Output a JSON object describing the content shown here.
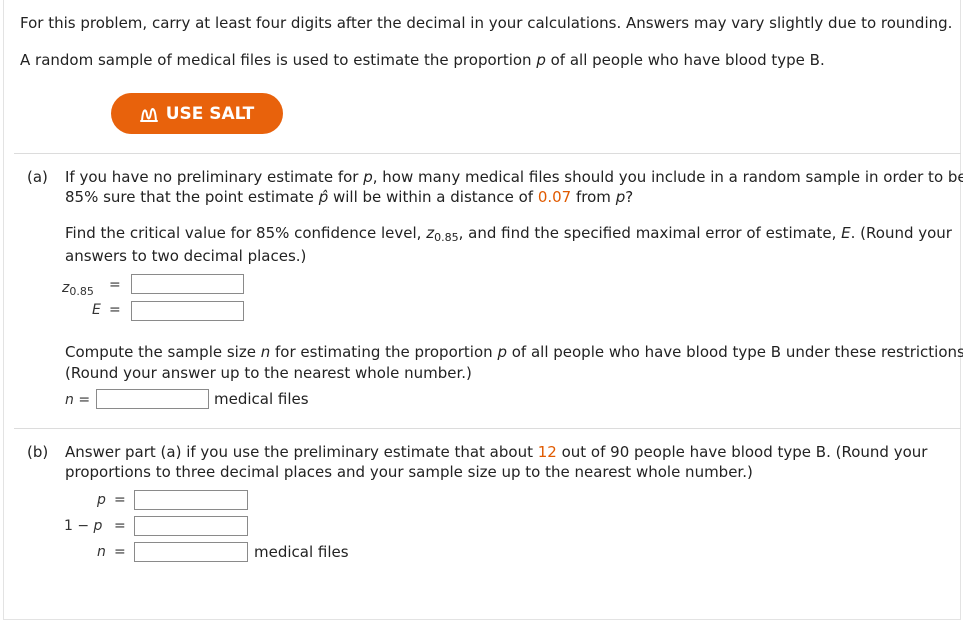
{
  "intro": {
    "line1": "For this problem, carry at least four digits after the decimal in your calculations. Answers may vary slightly due to rounding.",
    "line2_pre": "A random sample of medical files is used to estimate the proportion ",
    "line2_var": "p",
    "line2_post": " of all people who have blood type B."
  },
  "salt_button": {
    "label": "USE SALT",
    "icon": "salt-icon"
  },
  "part_a": {
    "marker": "(a)",
    "q_l1_pre": "If you have no preliminary estimate for ",
    "q_l1_var": "p",
    "q_l1_post": ", how many medical files should you include in a random sample in order to be",
    "q_l2_pre": "85% sure that the point estimate ",
    "q_l2_var": "p̂",
    "q_l2_mid": " will be within a distance of ",
    "q_l2_value": "0.07",
    "q_l2_mid2": " from ",
    "q_l2_var2": "p",
    "q_l2_post": "?",
    "find_l1_pre": "Find the critical value for 85% confidence level, ",
    "find_l1_z": "z",
    "find_l1_sub": "0.85",
    "find_l1_mid": ", and find the specified maximal error of estimate, ",
    "find_l1_var": "E",
    "find_l1_post": ". (Round your",
    "find_l2": "answers to two decimal places.)",
    "z_label": "z",
    "z_sub": "0.85",
    "eq": "=",
    "e_label": "E",
    "z_value": "",
    "e_value": "",
    "compute_l1_pre": "Compute the sample size ",
    "compute_l1_var": "n",
    "compute_l1_mid": " for estimating the proportion ",
    "compute_l1_var2": "p",
    "compute_l1_post": " of all people who have blood type B under these restrictions.",
    "compute_l2": "(Round your answer up to the nearest whole number.)",
    "n_label": "n",
    "n_value": "",
    "n_unit": "medical files"
  },
  "part_b": {
    "marker": "(b)",
    "q_l1_pre": "Answer part (a) if you use the preliminary estimate that about ",
    "q_l1_value": "12",
    "q_l1_post": " out of 90 people have blood type B. (Round your",
    "q_l2": "proportions to three decimal places and your sample size up to the nearest whole number.)",
    "p_label": "p",
    "one_minus": "1 − ",
    "eq": "=",
    "n_label": "n",
    "p_value": "",
    "one_minus_p_value": "",
    "n_value": "",
    "n_unit": "medical files"
  },
  "colors": {
    "accent": "#e8620c",
    "highlight": "#e05a00",
    "text": "#222222"
  }
}
